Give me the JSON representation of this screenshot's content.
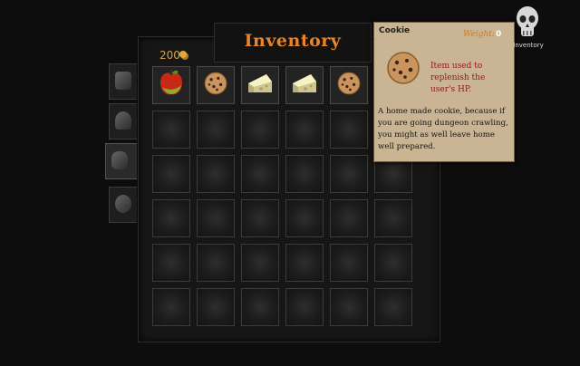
{
  "header": {
    "title": "Inventory"
  },
  "currency": {
    "gold_amount": "200"
  },
  "side_tabs": [
    {
      "name": "tab-equipment",
      "icon": "boots-icon",
      "active": false
    },
    {
      "name": "tab-armor",
      "icon": "helmet-icon",
      "active": false
    },
    {
      "name": "tab-bag",
      "icon": "bag-icon",
      "active": true
    },
    {
      "name": "tab-crafting",
      "icon": "gear-icon",
      "active": false
    }
  ],
  "grid": {
    "rows": 6,
    "cols": 6,
    "items": [
      {
        "row": 0,
        "col": 0,
        "icon": "apple-icon"
      },
      {
        "row": 0,
        "col": 1,
        "icon": "cookie-icon"
      },
      {
        "row": 0,
        "col": 2,
        "icon": "cheese-icon"
      },
      {
        "row": 0,
        "col": 3,
        "icon": "cheese-icon"
      },
      {
        "row": 0,
        "col": 4,
        "icon": "cookie-icon"
      }
    ]
  },
  "tooltip": {
    "item_name": "Cookie",
    "weight_label": "Weight:",
    "weight_value": "0",
    "short_description": "Item used to replenish the user's HP.",
    "long_description": "A home made cookie, because if you are going dungeon crawling, you might as well leave home well prepared.",
    "icon": "cookie-icon"
  },
  "top_right": {
    "icon": "skull-icon",
    "label": "Inventory"
  },
  "colors": {
    "title": "#e8842a",
    "weight_label": "#d67b18",
    "short_desc": "#8e1b1b",
    "parchment": "#c9b493"
  }
}
